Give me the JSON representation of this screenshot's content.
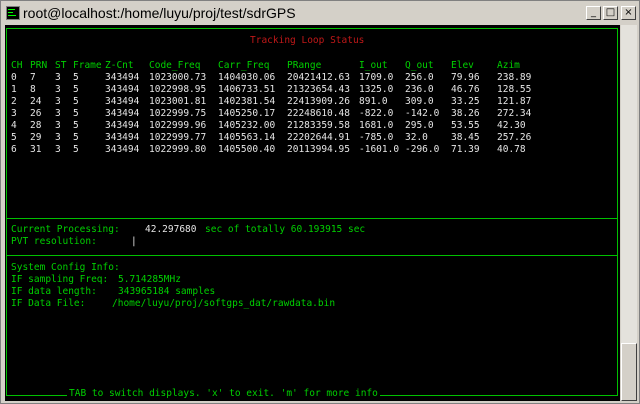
{
  "window": {
    "title": "root@localhost:/home/luyu/proj/test/sdrGPS",
    "buttons": {
      "minimize": "_",
      "maximize": "□",
      "close": "×"
    }
  },
  "tracking": {
    "title": "Tracking Loop Status",
    "columns": [
      "CH",
      "PRN",
      "ST",
      "Frame",
      "Z-Cnt",
      "Code_Freq",
      "Carr_Freq",
      "PRange",
      "I_out",
      "Q_out",
      "Elev",
      "Azim"
    ],
    "rows": [
      [
        "0",
        "7",
        "3",
        "5",
        "343494",
        "1023000.73",
        "1404030.06",
        "20421412.63",
        "1709.0",
        "256.0",
        "79.96",
        "238.89"
      ],
      [
        "1",
        "8",
        "3",
        "5",
        "343494",
        "1022998.95",
        "1406733.51",
        "21323654.43",
        "1325.0",
        "236.0",
        "46.76",
        "128.55"
      ],
      [
        "2",
        "24",
        "3",
        "5",
        "343494",
        "1023001.81",
        "1402381.54",
        "22413909.26",
        "891.0",
        "309.0",
        "33.25",
        "121.87"
      ],
      [
        "3",
        "26",
        "3",
        "5",
        "343494",
        "1022999.75",
        "1405250.17",
        "22248610.48",
        "-822.0",
        "-142.0",
        "38.26",
        "272.34"
      ],
      [
        "4",
        "28",
        "3",
        "5",
        "343494",
        "1022999.96",
        "1405232.00",
        "21283359.58",
        "1681.0",
        "295.0",
        "53.55",
        "42.30"
      ],
      [
        "5",
        "29",
        "3",
        "5",
        "343494",
        "1022999.77",
        "1405563.14",
        "22202644.91",
        "-785.0",
        "32.0",
        "38.45",
        "257.26"
      ],
      [
        "6",
        "31",
        "3",
        "5",
        "343494",
        "1022999.80",
        "1405500.40",
        "20113994.95",
        "-1601.0",
        "-296.0",
        "71.39",
        "40.78"
      ]
    ]
  },
  "processing": {
    "current_label": "Current Processing:",
    "current_value": "42.297680",
    "current_suffix": "sec of totally 60.193915 sec",
    "pvt_label": "PVT resolution:",
    "pvt_value": "|"
  },
  "config": {
    "title": "System Config Info:",
    "sampling_label": "IF sampling Freq:",
    "sampling_value": "5.714285MHz",
    "length_label": "IF data length:",
    "length_value": "343965184 samples",
    "file_label": "IF Data File:",
    "file_value": "/home/luyu/proj/softgps_dat/rawdata.bin"
  },
  "footer": "TAB to switch displays. 'x' to exit. 'm' for more info",
  "colors": {
    "terminal_bg": "#000000",
    "border": "#00c000",
    "title_red": "#c01818",
    "text": "#e6e6e6",
    "label_green": "#00d000"
  }
}
